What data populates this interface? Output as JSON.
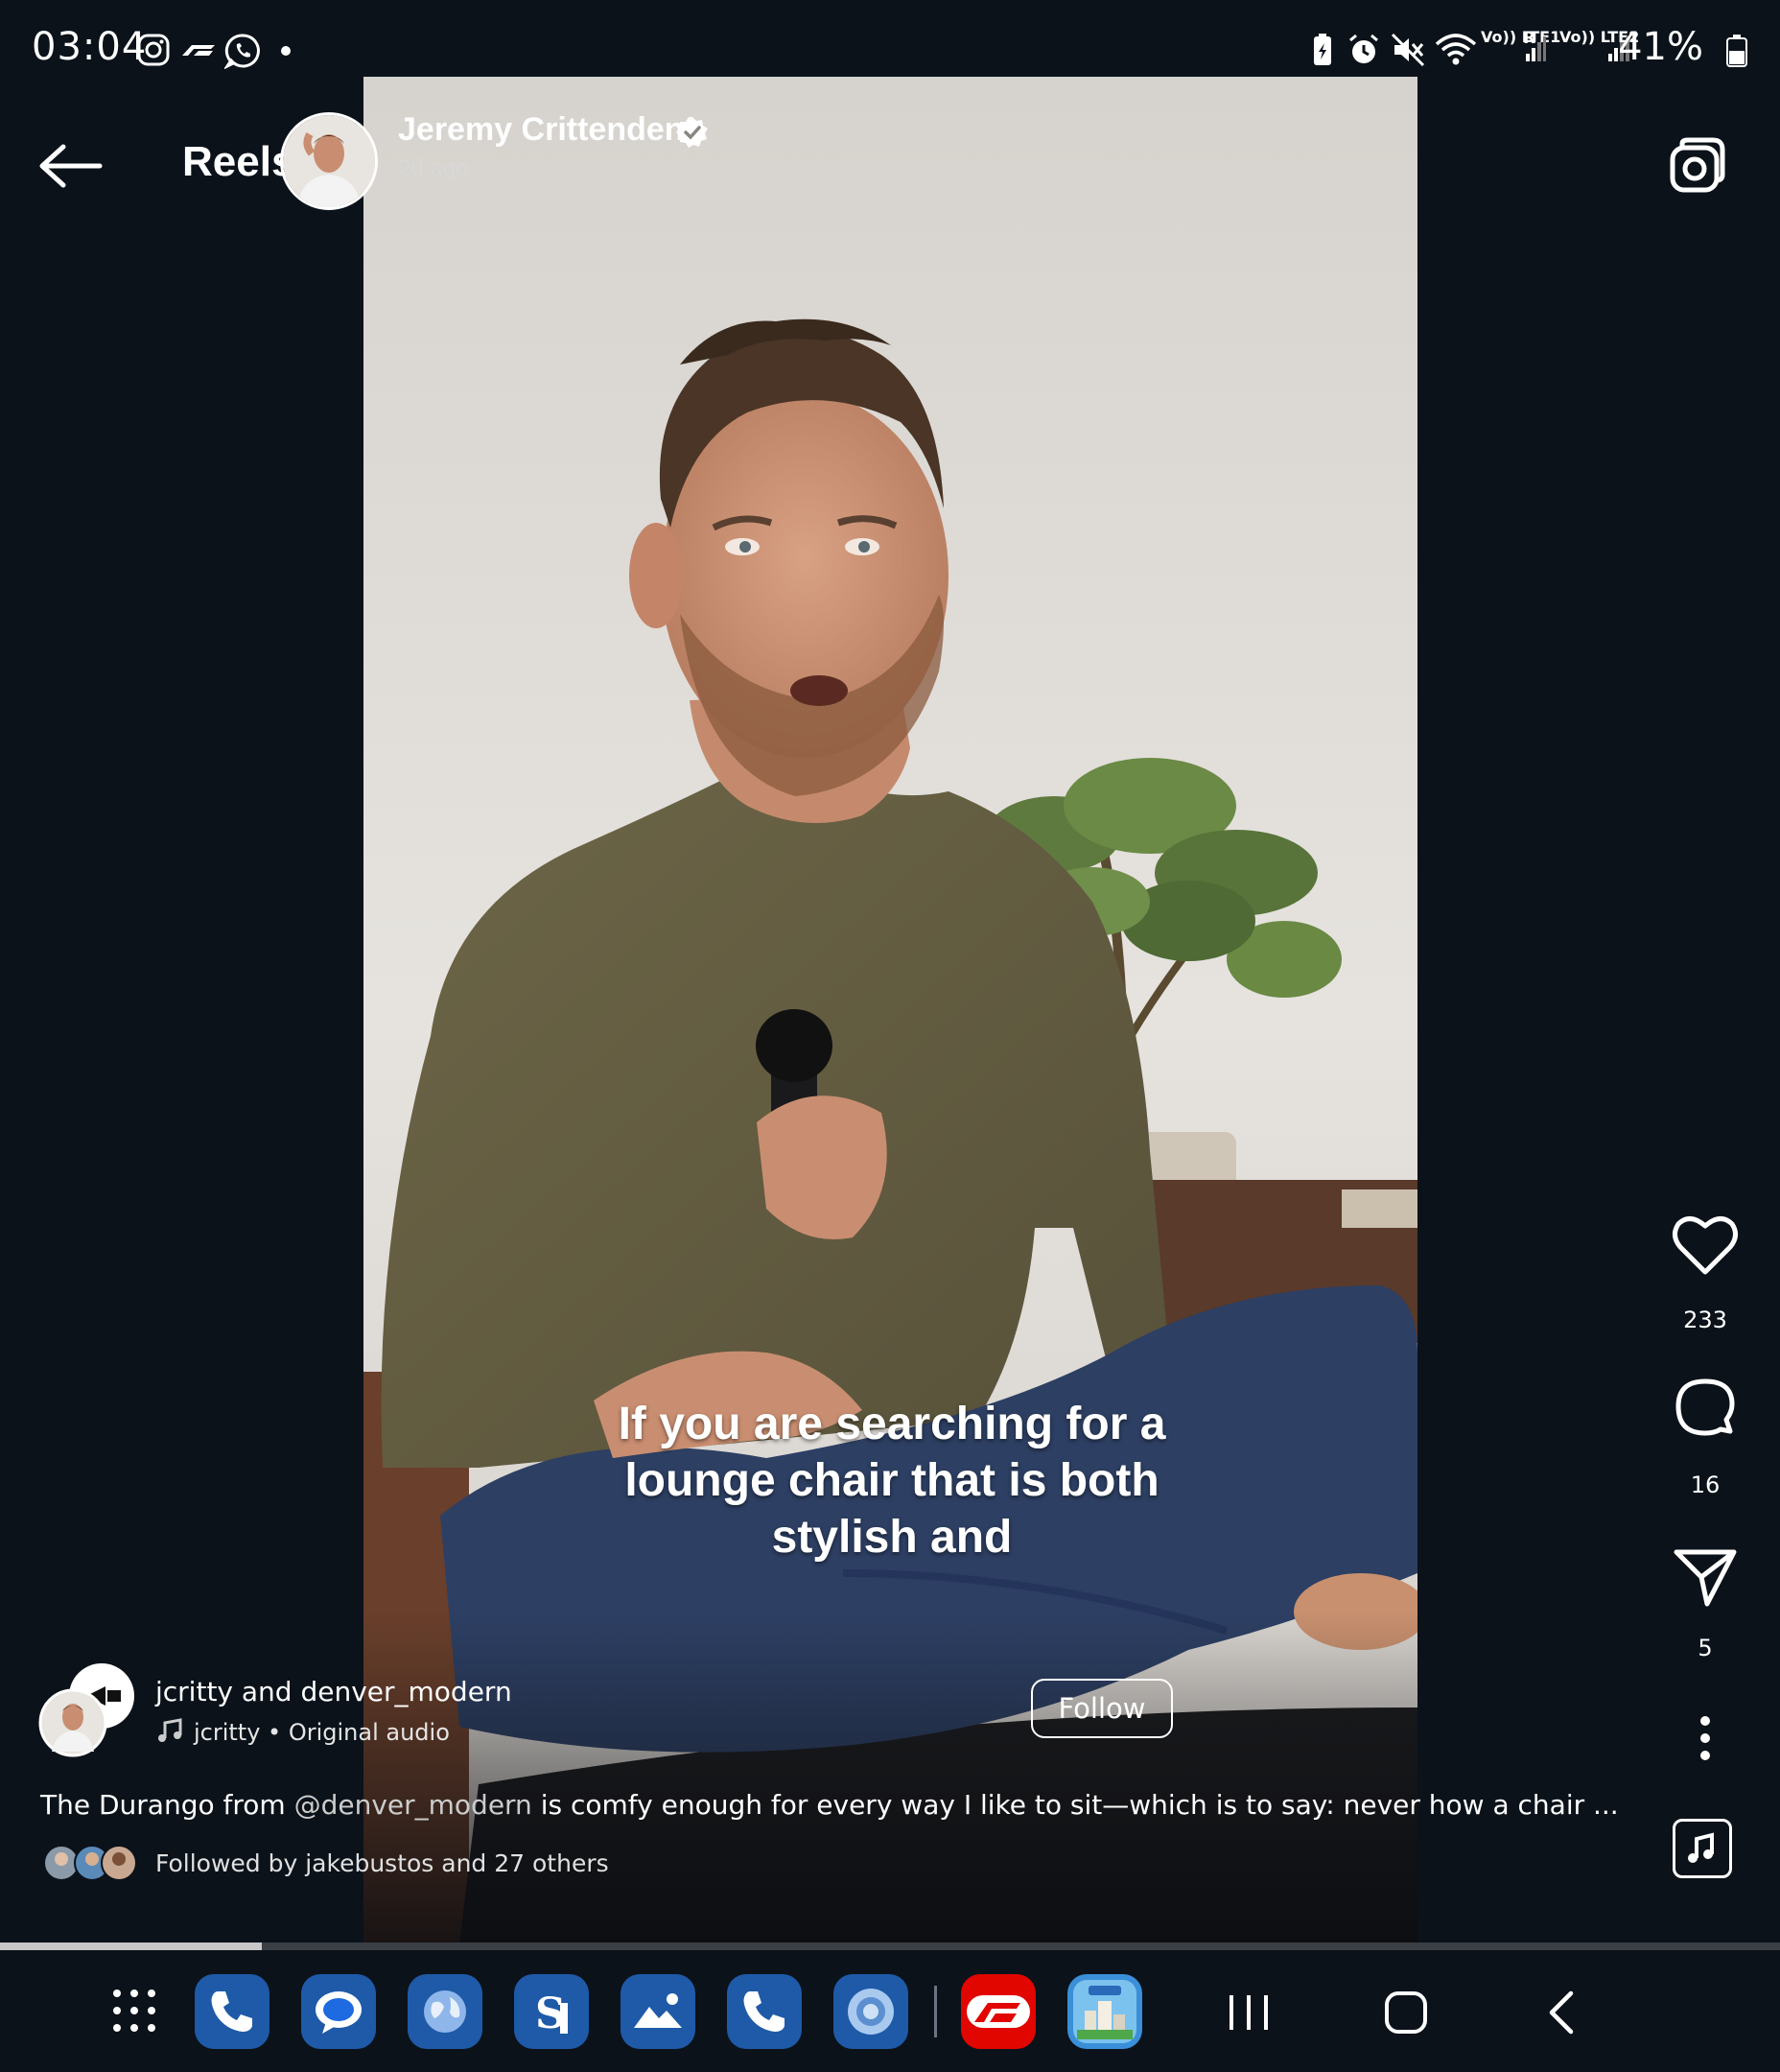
{
  "status_bar": {
    "time": "03:04",
    "battery": "41%",
    "network_1": "Vo)) LTE1",
    "network_2": "Vo)) LTE2",
    "roaming": "R",
    "left_icons": [
      "instagram-icon",
      "f1-icon",
      "whatsapp-icon",
      "dot-icon"
    ],
    "right_icons": [
      "battery-saver-icon",
      "alarm-icon",
      "mute-icon",
      "wifi-icon",
      "signal-icon",
      "signal-icon",
      "battery-icon"
    ]
  },
  "header": {
    "title": "Reels",
    "back_icon": "arrow-left-icon",
    "camera_icon": "camera-icon"
  },
  "video": {
    "author_name": "Jeremy Crittenden",
    "verified_icon": "verified-badge-icon",
    "posted": "2d ago",
    "caption_lines": [
      "If you are searching for a",
      "lounge chair that is both",
      "stylish and"
    ]
  },
  "actions": {
    "like_count": "233",
    "comment_count": "16",
    "share_count": "5",
    "icons": [
      "heart-icon",
      "comment-icon",
      "send-icon",
      "more-icon",
      "music-icon"
    ]
  },
  "post": {
    "collaborators": "jcritty and denver_modern",
    "audio_author": "jcritty",
    "audio_title": "Original audio",
    "follow_label": "Follow",
    "caption_prefix": "The Durango from ",
    "caption_mention": "@denver_modern",
    "caption_suffix": " is comfy enough for every way I like to sit—which is to say: never how a chair ...",
    "followed_by": "Followed by jakebustos and 27 others",
    "progress": 0.147
  },
  "dock": {
    "apps": [
      "app-drawer-icon",
      "phone-icon",
      "messages-icon",
      "browser-icon",
      "s-app-icon",
      "gallery-icon",
      "phone-icon",
      "camera-lens-icon",
      "f1-app-icon",
      "simcity-icon"
    ],
    "nav": [
      "recents-icon",
      "home-icon",
      "back-icon"
    ]
  },
  "colors": {
    "background": "#0b121a",
    "wall": "#e4e1dc",
    "shirt": "#6a6343",
    "jeans": "#2d3f63",
    "app_blue": "#1e5aa8"
  }
}
